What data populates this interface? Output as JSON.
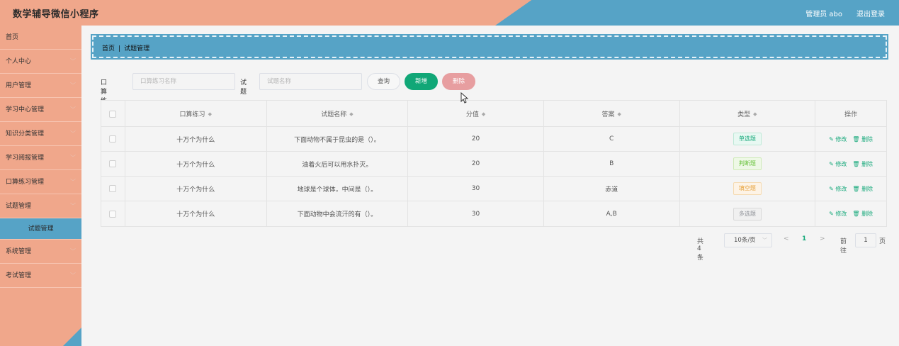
{
  "header": {
    "title": "数学辅导微信小程序",
    "admin": "管理员 abo",
    "logout": "退出登录"
  },
  "sidebar": {
    "items": [
      {
        "label": "首页",
        "chevron": false
      },
      {
        "label": "个人中心",
        "chevron": true
      },
      {
        "label": "用户管理",
        "chevron": true
      },
      {
        "label": "学习中心管理",
        "chevron": true
      },
      {
        "label": "知识分类管理",
        "chevron": true
      },
      {
        "label": "学习阅报管理",
        "chevron": true
      },
      {
        "label": "口算练习管理",
        "chevron": true
      },
      {
        "label": "试题管理",
        "chevron": true
      },
      {
        "label": "试题管理",
        "sub": true
      },
      {
        "label": "系统管理",
        "chevron": true
      },
      {
        "label": "考试管理",
        "chevron": true
      }
    ]
  },
  "breadcrumb": {
    "home": "首页",
    "separator": "|",
    "current": "试题管理"
  },
  "search": {
    "label1": "口算练习",
    "placeholder1": "口算练习名称",
    "label2": "试题",
    "placeholder2": "试题名称",
    "query_btn": "查询",
    "add_btn": "新增",
    "delete_btn": "删除"
  },
  "table": {
    "headers": [
      "口算练习",
      "试题名称",
      "分值",
      "答案",
      "类型",
      "操作"
    ],
    "rows": [
      {
        "practice": "十万个为什么",
        "question": "下面动物不属于昆虫的是（）。",
        "score": "20",
        "answer": "C",
        "type": "单选题"
      },
      {
        "practice": "十万个为什么",
        "question": "油着火后可以用水扑灭。",
        "score": "20",
        "answer": "B",
        "type": "判断题"
      },
      {
        "practice": "十万个为什么",
        "question": "地球是个球体，中间是（）。",
        "score": "30",
        "answer": "赤道",
        "type": "填空题"
      },
      {
        "practice": "十万个为什么",
        "question": "下面动物中会流汗的有（）。",
        "score": "30",
        "answer": "A,B",
        "type": "多选题"
      }
    ],
    "edit_label": "修改",
    "delete_label": "删除"
  },
  "type_colors": {
    "单选题": {
      "bg": "#e8f8f2",
      "border": "#bfe9d8",
      "text": "#17a97b"
    },
    "判断题": {
      "bg": "#eef8e6",
      "border": "#cfeab8",
      "text": "#67c23a"
    },
    "填空题": {
      "bg": "#fdf3e6",
      "border": "#f5dab1",
      "text": "#e6a23c"
    },
    "多选题": {
      "bg": "#f0f0f0",
      "border": "#d9d9d9",
      "text": "#909399"
    }
  },
  "pagination": {
    "total": "共 4 条",
    "page_size": "10条/页",
    "current": "1",
    "goto_label": "前往",
    "goto_value": "1",
    "page_suffix": "页"
  }
}
